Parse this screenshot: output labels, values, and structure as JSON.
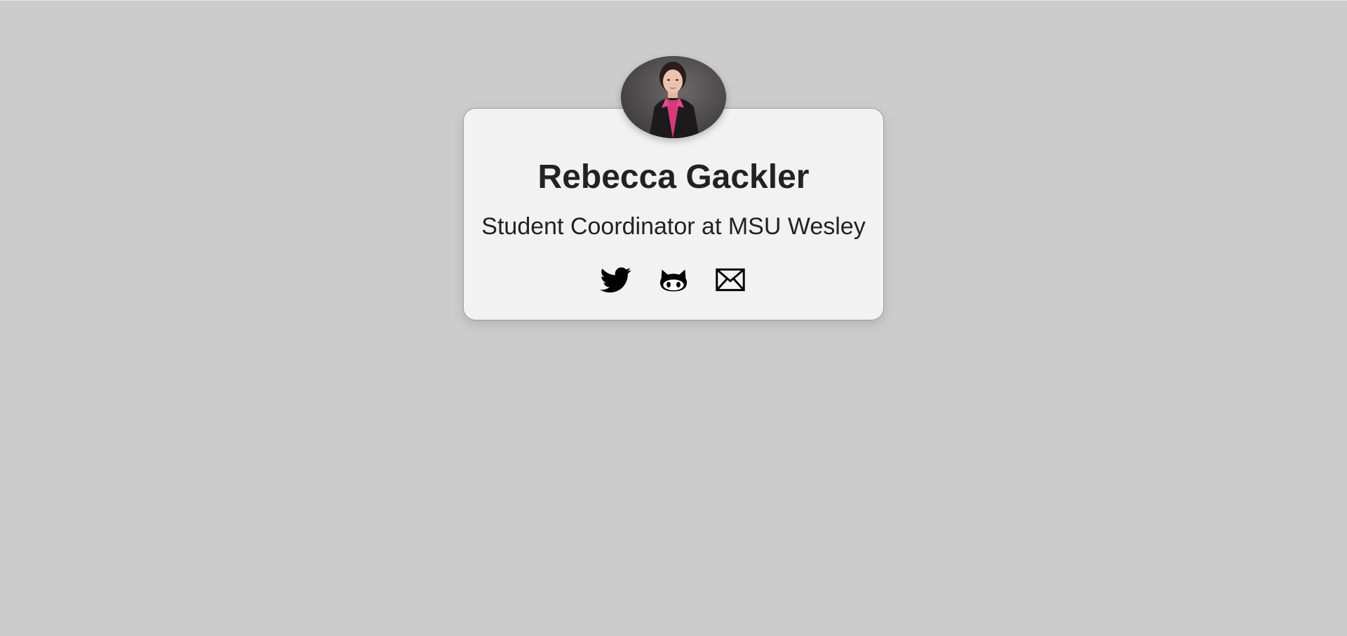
{
  "profile": {
    "name": "Rebecca Gackler",
    "title": "Student Coordinator at MSU Wesley",
    "avatar_alt": "Rebecca Gackler"
  },
  "links": [
    {
      "icon": "twitter-icon",
      "label": "Twitter"
    },
    {
      "icon": "github-icon",
      "label": "GitHub"
    },
    {
      "icon": "email-icon",
      "label": "Email"
    }
  ],
  "colors": {
    "background": "#cccccc",
    "card": "#f2f2f2",
    "text": "#222222",
    "icon": "#000000",
    "shirt_accent": "#d63a7a"
  }
}
